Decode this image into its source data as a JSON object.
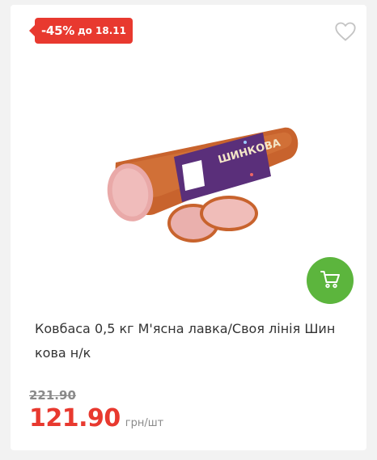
{
  "badge": {
    "discount": "-45%",
    "until": "до 18.11",
    "color": "#e8392f"
  },
  "favorite": {
    "icon": "heart-outline-icon"
  },
  "product": {
    "title": "Ковбаса 0,5 кг М'ясна лавка/Своя лінія Шин кова н/к",
    "image_label": "ШИНКОВА"
  },
  "cart": {
    "icon": "cart-icon",
    "color": "#5cb53d"
  },
  "price": {
    "old": "221.90",
    "current": "121.90",
    "unit": "грн/шт"
  }
}
